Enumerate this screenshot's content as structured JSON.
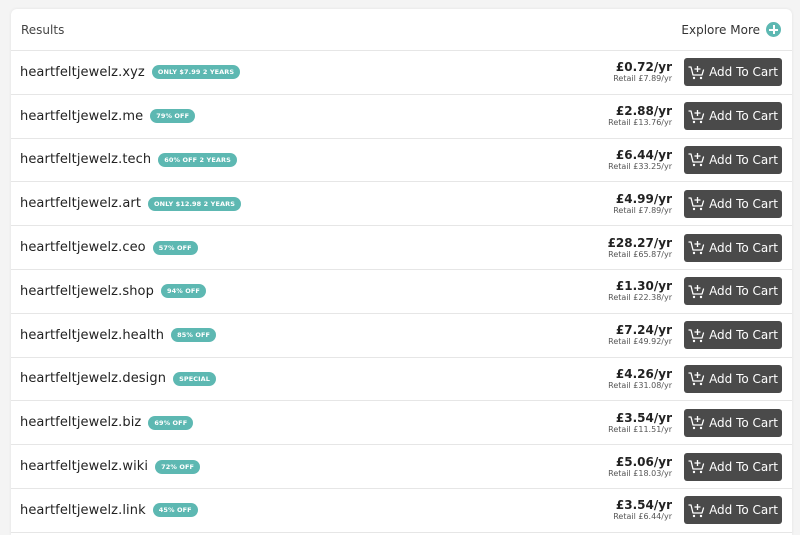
{
  "header": {
    "title": "Results",
    "explore_label": "Explore More",
    "explore_icon": "plus-circle-icon"
  },
  "colors": {
    "accent": "#5db8b2",
    "button_bg": "#4a4a4a"
  },
  "cart_label": "Add To Cart",
  "rows": [
    {
      "domain": "heartfeltjewelz.xyz",
      "badge": "ONLY $7.99 2 YEARS",
      "price": "£0.72/yr",
      "retail": "Retail £7.89/yr"
    },
    {
      "domain": "heartfeltjewelz.me",
      "badge": "79% OFF",
      "price": "£2.88/yr",
      "retail": "Retail £13.76/yr"
    },
    {
      "domain": "heartfeltjewelz.tech",
      "badge": "60% OFF 2 YEARS",
      "price": "£6.44/yr",
      "retail": "Retail £33.25/yr"
    },
    {
      "domain": "heartfeltjewelz.art",
      "badge": "ONLY $12.98 2 YEARS",
      "price": "£4.99/yr",
      "retail": "Retail £7.89/yr"
    },
    {
      "domain": "heartfeltjewelz.ceo",
      "badge": "57% OFF",
      "price": "£28.27/yr",
      "retail": "Retail £65.87/yr"
    },
    {
      "domain": "heartfeltjewelz.shop",
      "badge": "94% OFF",
      "price": "£1.30/yr",
      "retail": "Retail £22.38/yr"
    },
    {
      "domain": "heartfeltjewelz.health",
      "badge": "85% OFF",
      "price": "£7.24/yr",
      "retail": "Retail £49.92/yr"
    },
    {
      "domain": "heartfeltjewelz.design",
      "badge": "SPECIAL",
      "price": "£4.26/yr",
      "retail": "Retail £31.08/yr"
    },
    {
      "domain": "heartfeltjewelz.biz",
      "badge": "69% OFF",
      "price": "£3.54/yr",
      "retail": "Retail £11.51/yr"
    },
    {
      "domain": "heartfeltjewelz.wiki",
      "badge": "72% OFF",
      "price": "£5.06/yr",
      "retail": "Retail £18.03/yr"
    },
    {
      "domain": "heartfeltjewelz.link",
      "badge": "45% OFF",
      "price": "£3.54/yr",
      "retail": "Retail £6.44/yr"
    }
  ]
}
